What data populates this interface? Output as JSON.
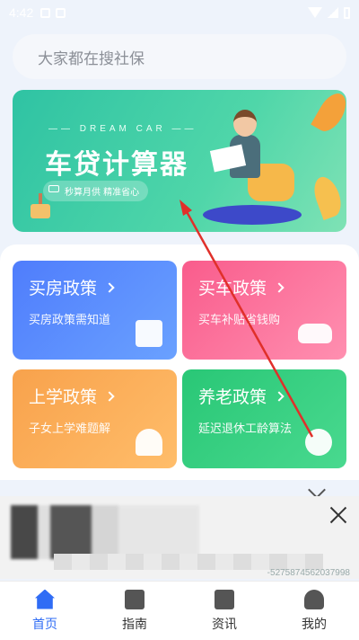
{
  "status": {
    "time": "4:42"
  },
  "search": {
    "placeholder": "大家都在搜社保"
  },
  "banner": {
    "subtitle": "—— DREAM CAR ——",
    "title": "车贷计算器",
    "tagline": "秒算月供 精准省心"
  },
  "cards": [
    {
      "title": "买房政策",
      "desc": "买房政策需知道",
      "icon": "building-icon"
    },
    {
      "title": "买车政策",
      "desc": "买车补贴省钱购",
      "icon": "car-icon"
    },
    {
      "title": "上学政策",
      "desc": "子女上学难题解",
      "icon": "school-icon"
    },
    {
      "title": "养老政策",
      "desc": "延迟退休工龄算法",
      "icon": "elder-icon"
    }
  ],
  "ad": {
    "id_text": "-5275874562037998"
  },
  "tabs": [
    {
      "label": "首页",
      "icon": "home-icon",
      "active": true
    },
    {
      "label": "指南",
      "icon": "calculator-icon"
    },
    {
      "label": "资讯",
      "icon": "news-icon"
    },
    {
      "label": "我的",
      "icon": "person-icon"
    }
  ],
  "colors": {
    "accent": "#2f6cf5",
    "annotation": "#e0302a"
  }
}
